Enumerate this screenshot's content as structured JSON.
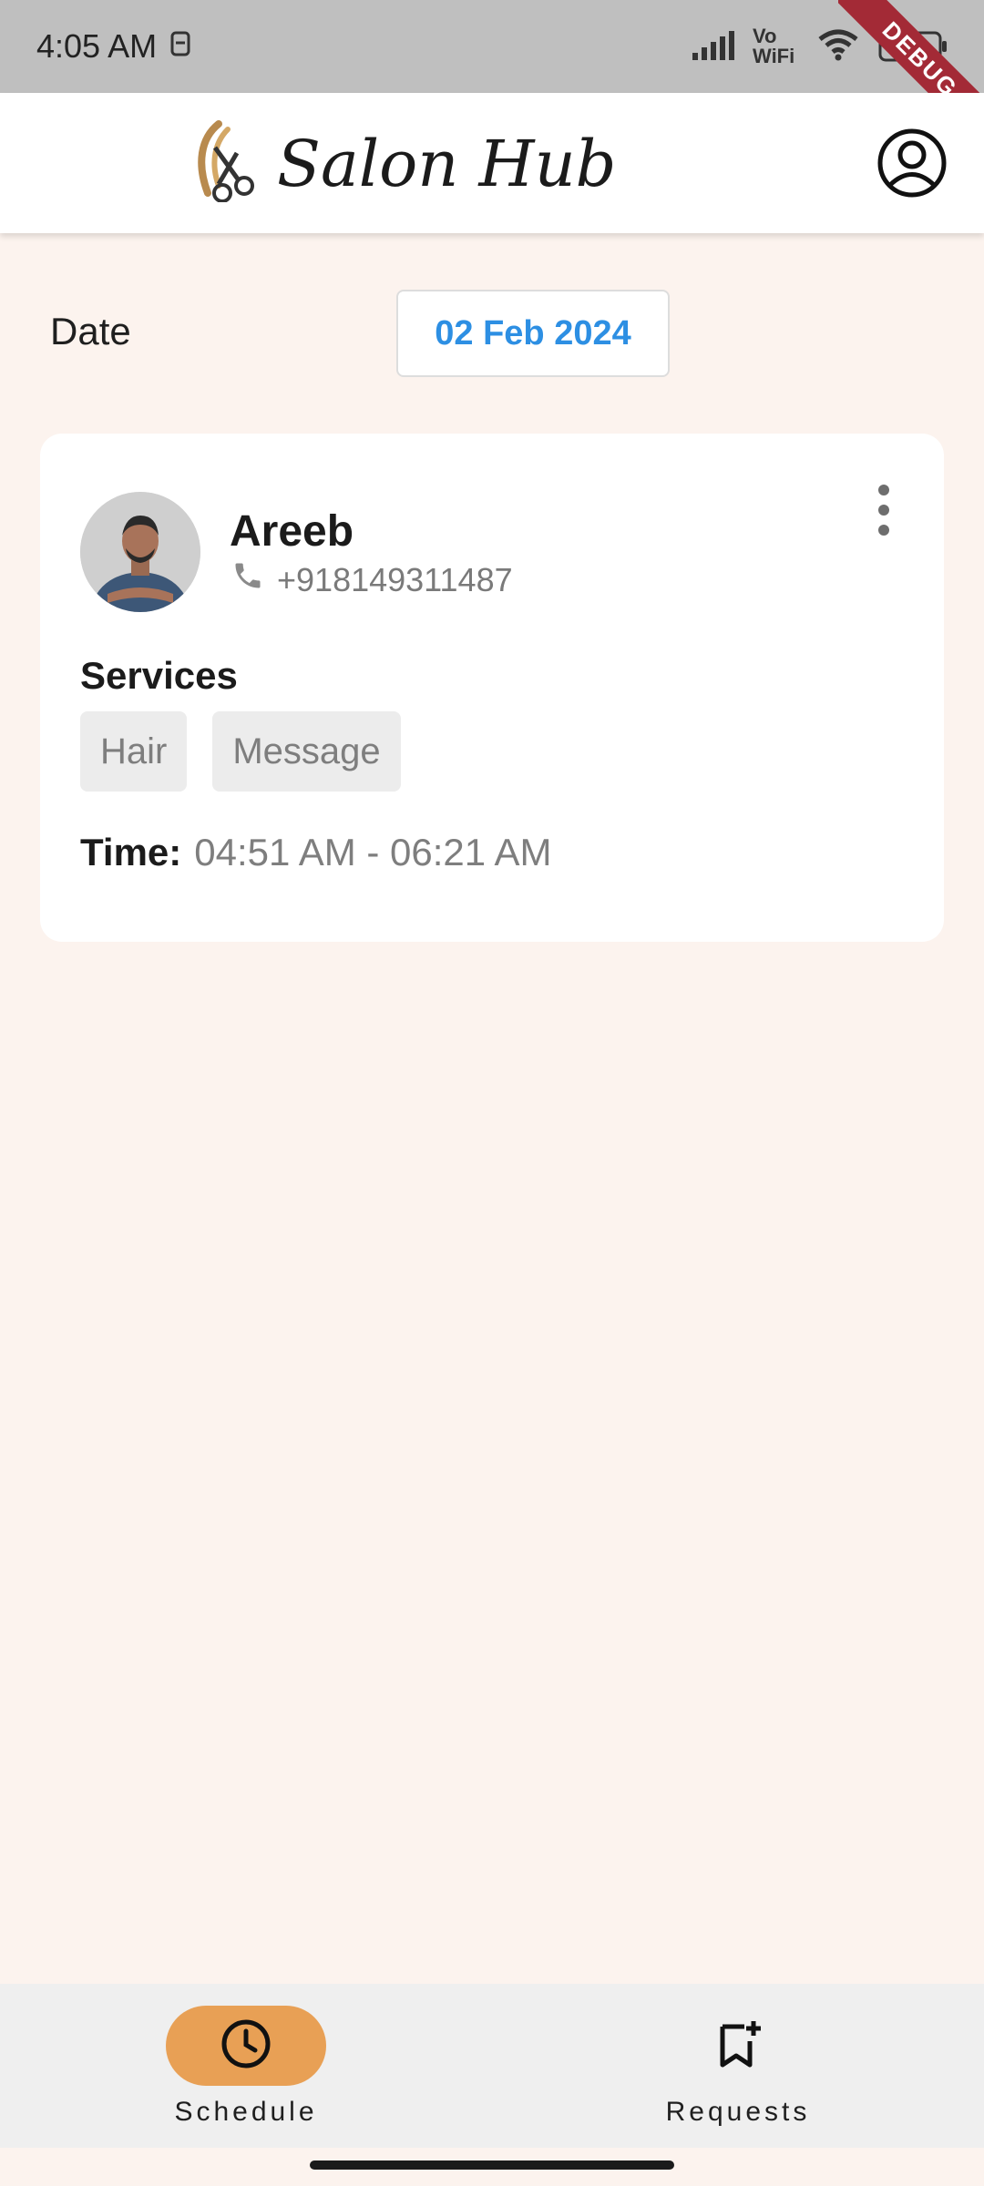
{
  "status_bar": {
    "time": "4:05 AM",
    "network": "Vo WiFi",
    "battery": "67"
  },
  "debug_banner": "DEBUG",
  "app_bar": {
    "brand": "Salon Hub"
  },
  "date_row": {
    "label": "Date",
    "value": "02 Feb 2024"
  },
  "appointment": {
    "client_name": "Areeb",
    "phone": "+918149311487",
    "services_title": "Services",
    "services": [
      "Hair",
      "Message"
    ],
    "time_label": "Time:",
    "time_value": "04:51 AM - 06:21 AM"
  },
  "bottom_nav": {
    "items": [
      {
        "label": "Schedule",
        "icon": "clock-icon",
        "active": true
      },
      {
        "label": "Requests",
        "icon": "bookmark-add-icon",
        "active": false
      }
    ]
  },
  "colors": {
    "background": "#fcf3ee",
    "accent": "#e8a055",
    "date_text": "#2d8fe3",
    "debug": "#a32a36"
  }
}
